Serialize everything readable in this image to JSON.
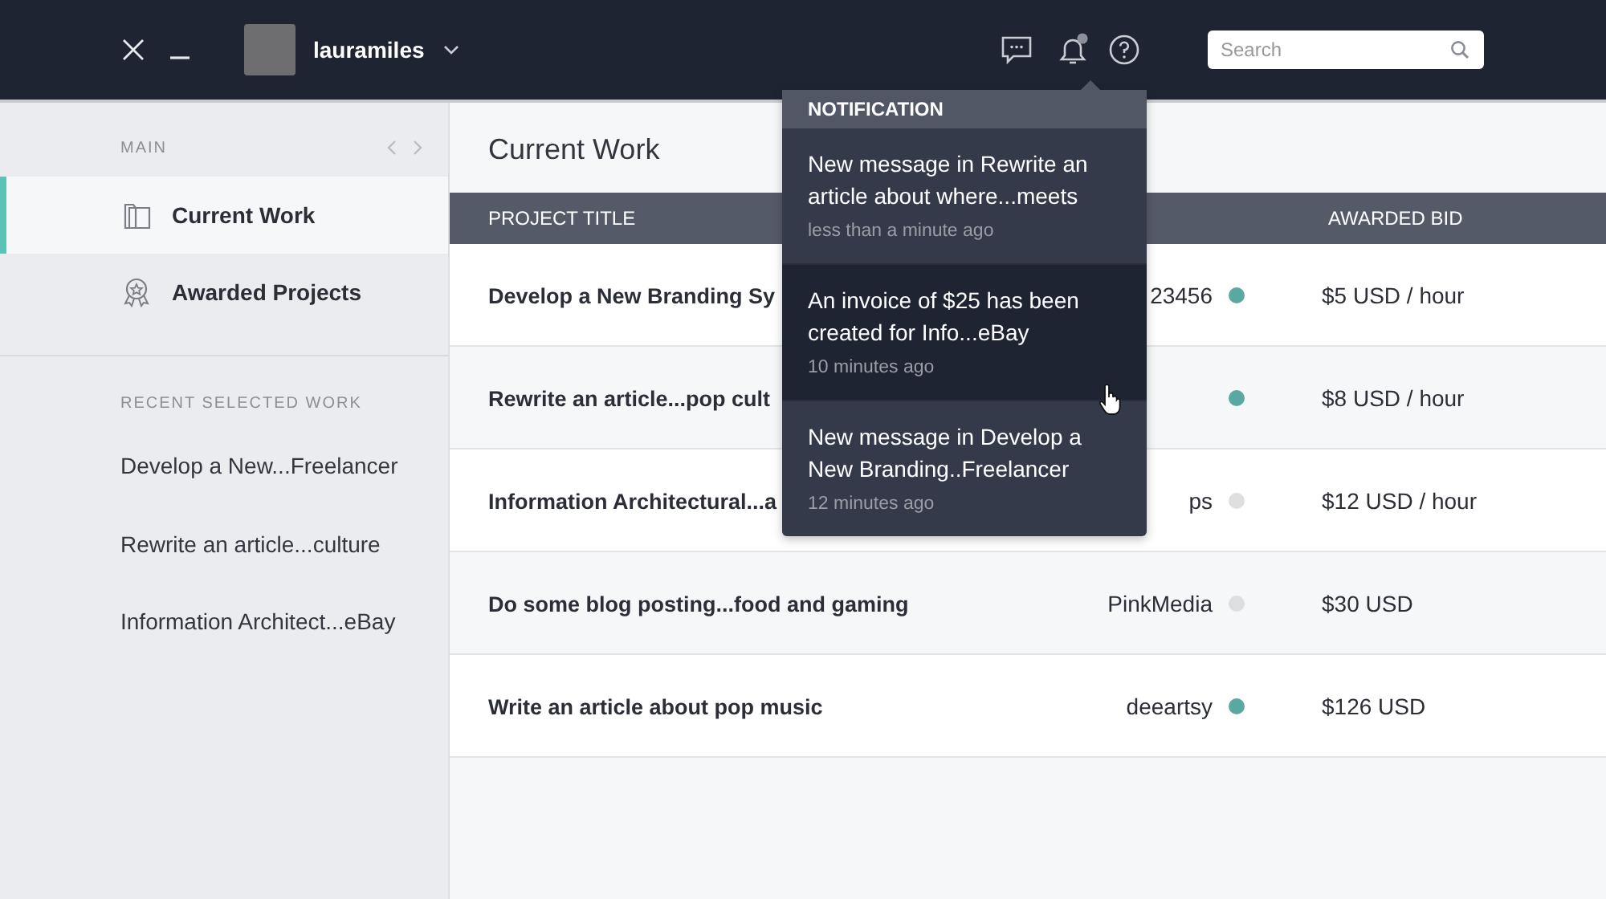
{
  "topbar": {
    "username": "lauramiles",
    "search": {
      "placeholder": "Search"
    },
    "bell_unread": true
  },
  "sidebar": {
    "section_title": "MAIN",
    "items": [
      {
        "label": "Current Work",
        "selected": true
      },
      {
        "label": "Awarded Projects",
        "selected": false
      }
    ],
    "recent_title": "RECENT SELECTED WORK",
    "recent": [
      "Develop a New...Freelancer",
      "Rewrite an article...culture",
      "Information Architect...eBay"
    ]
  },
  "page_title": "Current Work",
  "table": {
    "columns": [
      "PROJECT TITLE",
      "AWARDED BID"
    ],
    "rows": [
      {
        "title": "Develop a New Branding Sy",
        "client": "23456",
        "color": "#5ba8a0",
        "bid": "$5 USD / hour"
      },
      {
        "title": "Rewrite an article...pop cult",
        "color": "#5ba8a0",
        "bid": "$8 USD / hour"
      },
      {
        "title": "Information Architectural...a",
        "client": "ps",
        "color": "#dddee0",
        "bid": "$12 USD / hour"
      },
      {
        "title": "Do some blog posting...food and gaming",
        "client": "PinkMedia",
        "color": "#dddee0",
        "bid": "$30 USD"
      },
      {
        "title": "Write an article about pop music",
        "client": "deeartsy",
        "color": "#5ba8a0",
        "bid": "$126 USD"
      }
    ]
  },
  "notifications": {
    "title": "NOTIFICATION",
    "items": [
      {
        "text": "New message in Rewrite an article about where...meets",
        "time": "less than a minute ago",
        "hovered": false
      },
      {
        "text": "An invoice of $25 has been created for Info...eBay",
        "time": "10 minutes ago",
        "hovered": true
      },
      {
        "text": "New message in Develop a New Branding..Freelancer",
        "time": "12 minutes ago",
        "hovered": false
      }
    ]
  }
}
